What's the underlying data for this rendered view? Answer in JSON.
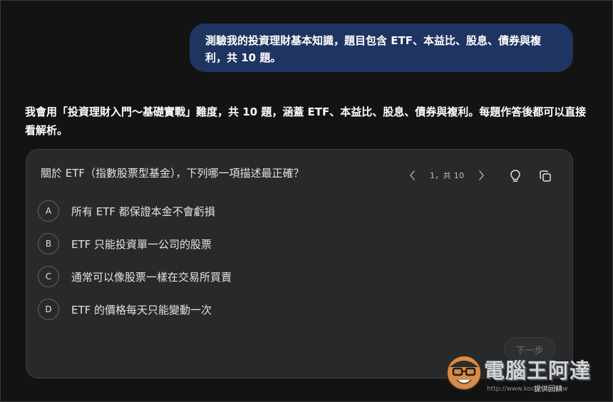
{
  "user_message": "測驗我的投資理財基本知識，題目包含 ETF、本益比、股息、債券與複利，共 10 題。",
  "assistant_intro_parts": {
    "before": "我會用「投資理財入門～基礎實戰」難度，共 10 題，涵蓋 ",
    "topics": "ETF、本益比、股息、債券與複利",
    "after": "。每題作答後都可以直接看解析。"
  },
  "quiz": {
    "question": "關於 ETF（指數股票型基金），下列哪一項描述最正確？",
    "page_indicator": "1，共 10",
    "options": [
      {
        "letter": "A",
        "text": "所有 ETF 都保證本金不會虧損"
      },
      {
        "letter": "B",
        "text": "ETF 只能投資單一公司的股票"
      },
      {
        "letter": "C",
        "text": "通常可以像股票一樣在交易所買賣"
      },
      {
        "letter": "D",
        "text": "ETF 的價格每天只能變動一次"
      }
    ],
    "next_label": "下一步"
  },
  "icons": {
    "prev": "chevron-left-icon",
    "next": "chevron-right-icon",
    "hint": "lightbulb-icon",
    "copy": "copy-icon"
  },
  "watermark": {
    "title": "電腦王阿達",
    "subtitle": "提供回饋",
    "url": "http://www.kocpc.com.tw"
  },
  "colors": {
    "background": "#131314",
    "user_bubble": "#1f3561",
    "card": "#28292b"
  }
}
